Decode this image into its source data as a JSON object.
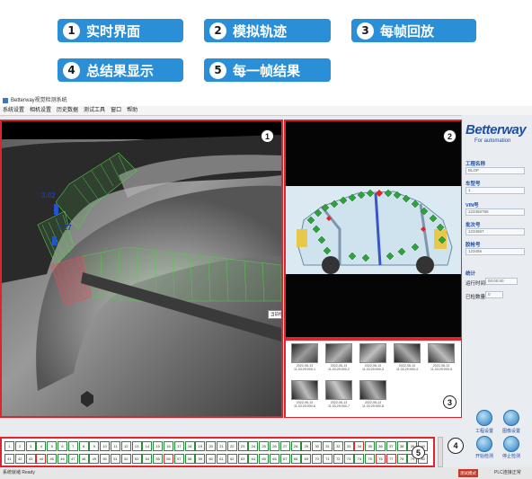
{
  "legend": [
    {
      "num": "1",
      "label": "实时界面"
    },
    {
      "num": "2",
      "label": "模拟轨迹"
    },
    {
      "num": "3",
      "label": "每帧回放"
    },
    {
      "num": "4",
      "label": "总结果显示"
    },
    {
      "num": "5",
      "label": "每一帧结果"
    }
  ],
  "window": {
    "title": "Betterway视觉检测系统",
    "menu": [
      "系统设置",
      "相机设置",
      "历史数据",
      "测试工具",
      "窗口",
      "帮助"
    ]
  },
  "camera": {
    "measure_a": "3.02",
    "measure_b": "3.27",
    "tooltip": "当前检测位置"
  },
  "frame_badges": {
    "realtime": "1",
    "track": "2",
    "playback": "3",
    "summary": "4",
    "frame_result": "5"
  },
  "thumbnails": [
    {
      "caption": "2022-06-13 11:33:29:000-1"
    },
    {
      "caption": "2022-06-13 11:33:29:000-2"
    },
    {
      "caption": "2022-06-13 11:33:29:000-3"
    },
    {
      "caption": "2022-06-13 11:33:29:000-4"
    },
    {
      "caption": "2022-06-13 11:33:29:000-5"
    },
    {
      "caption": "2022-06-13 11:33:29:000-6"
    },
    {
      "caption": "2022-06-13 11:33:29:000-7"
    },
    {
      "caption": "2022-06-13 11:33:29:000-8"
    }
  ],
  "sidepanel": {
    "logo": "Betterway",
    "logo_sub": "For automation",
    "fields": [
      {
        "label": "工程名称",
        "value": "BLOP"
      },
      {
        "label": "车型号",
        "value": "1"
      },
      {
        "label": "VIN号",
        "value": "123456789"
      },
      {
        "label": "批次号",
        "value": "1234567"
      },
      {
        "label": "胶枪号",
        "value": "123456"
      }
    ],
    "stats_title": "统计",
    "runtime_label": "运行时间",
    "runtime_value": "00:00:00",
    "count_label": "已检数量",
    "count_value": "0",
    "buttons": [
      "工程设置",
      "图像设置",
      "开始检测",
      "停止检测"
    ]
  },
  "grid_rows": [
    {
      "cells": [
        "1",
        "2",
        "3",
        "4",
        "5",
        "6",
        "7",
        "8",
        "9",
        "10",
        "11",
        "12",
        "13",
        "14",
        "15",
        "16",
        "17",
        "18",
        "19",
        "20",
        "21",
        "22",
        "23",
        "24",
        "25",
        "26",
        "27",
        "28",
        "29",
        "30",
        "31",
        "32",
        "33",
        "34",
        "35",
        "36",
        "37",
        "38",
        "39",
        "40"
      ],
      "red": [
        0,
        9,
        28,
        33
      ]
    },
    {
      "cells": [
        "41",
        "42",
        "43",
        "44",
        "45",
        "46",
        "47",
        "48",
        "49",
        "50",
        "51",
        "52",
        "53",
        "54",
        "55",
        "56",
        "57",
        "58",
        "59",
        "60",
        "61",
        "62",
        "63",
        "64",
        "65",
        "66",
        "67",
        "68",
        "69",
        "70",
        "71",
        "72",
        "73",
        "74",
        "75",
        "76",
        "77",
        "78",
        "79",
        "80"
      ],
      "red": [
        3,
        11,
        15,
        31,
        35,
        36
      ]
    }
  ],
  "status": {
    "left": "系统就绪  Ready",
    "mode": "测试模式",
    "right": "PLC连接正常"
  },
  "colors": {
    "accent": "#2a8fd6",
    "frame": "#e0242d",
    "ok": "#2b8a3e"
  }
}
